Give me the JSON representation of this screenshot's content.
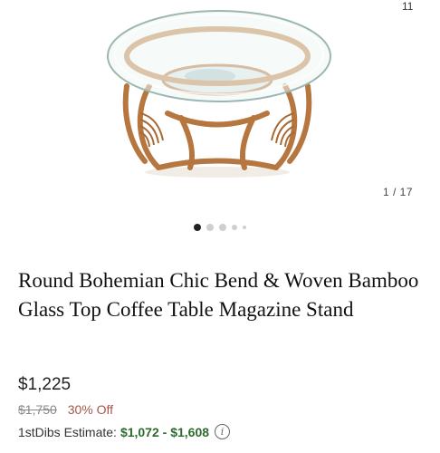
{
  "gallery": {
    "top_count": "11",
    "pager": "1 / 17",
    "dots": [
      true,
      false,
      false,
      false,
      false
    ],
    "image_alt": "coffee-table-photo"
  },
  "product": {
    "title": "Round Bohemian Chic Bend & Woven Bamboo Glass Top Coffee Table Magazine Stand",
    "price": "$1,225",
    "original_price": "$1,750",
    "discount": "30% Off",
    "estimate_label": "1stDibs Estimate:",
    "estimate_range": "$1,072 - $1,608",
    "info_icon": "i"
  },
  "colors": {
    "rattan": "#b5773f",
    "discount": "#a4564a",
    "estimate_green": "#2e6b2e"
  }
}
